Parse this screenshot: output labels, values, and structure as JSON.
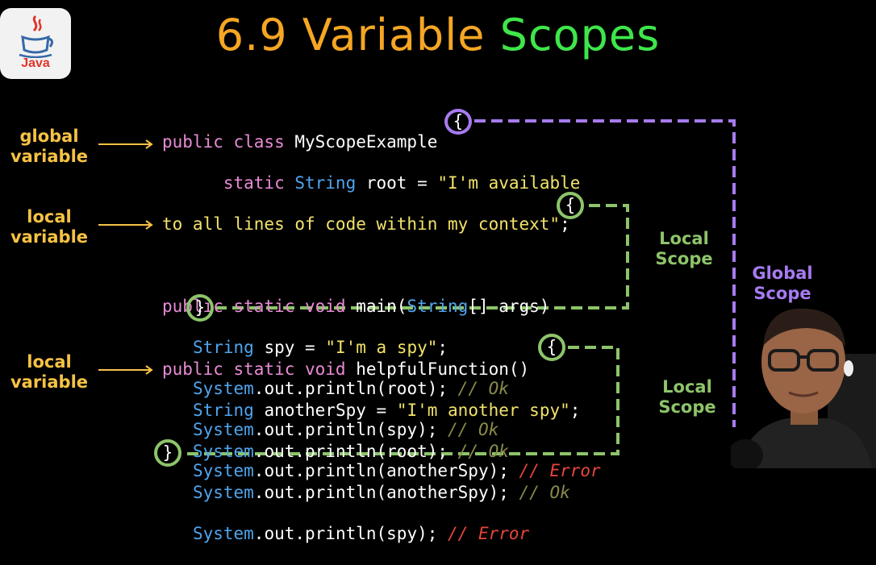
{
  "logo": {
    "text": "Java"
  },
  "title": {
    "part1": "6.9 Variable",
    "part2": "Scopes"
  },
  "side_labels": {
    "global": [
      "global",
      "variable"
    ],
    "local1": [
      "local",
      "variable"
    ],
    "local2": [
      "local",
      "variable"
    ]
  },
  "scope_labels": {
    "local1": [
      "Local",
      "Scope"
    ],
    "global": [
      "Global",
      "Scope"
    ],
    "local2": [
      "Local",
      "Scope"
    ]
  },
  "code": {
    "class_decl": {
      "kw": "public class",
      "name": " MyScopeExample "
    },
    "root_line": {
      "kw": "static",
      "type": " String",
      "rest": " root = ",
      "str": "\"I'm available"
    },
    "root_line2": {
      "str": "to all lines of code within my context\"",
      "end": ";"
    },
    "main_decl": {
      "kw": "public static void",
      "rest1": " main(",
      "type": "String",
      "rest2": "[] args) "
    },
    "spy_line": {
      "type": "String",
      "rest": " spy = ",
      "str": "\"I'm a spy\"",
      "end": ";"
    },
    "main_p1": {
      "type": "System",
      "rest": ".out.println(root); ",
      "comment": "// Ok"
    },
    "main_p2": {
      "type": "System",
      "rest": ".out.println(spy); ",
      "comment": "// Ok"
    },
    "main_p3": {
      "type": "System",
      "rest": ".out.println(anotherSpy); ",
      "comment": "// Error"
    },
    "helper_decl": {
      "kw": "public static void",
      "rest": " helpfulFunction() "
    },
    "another_line": {
      "type": "String",
      "rest": " anotherSpy = ",
      "str": "\"I'm another spy\"",
      "end": ";"
    },
    "helper_p1": {
      "type": "System",
      "rest": ".out.println(root); ",
      "comment": "// Ok"
    },
    "helper_p2": {
      "type": "System",
      "rest": ".out.println(anotherSpy); ",
      "comment": "// Ok"
    },
    "helper_p3": {
      "type": "System",
      "rest": ".out.println(spy); ",
      "comment": "// Error"
    },
    "open_brace": "{",
    "close_brace": "}"
  },
  "colors": {
    "global_scope": "#a77bf0",
    "local_scope": "#8dc46a",
    "label": "#f6c244",
    "title_orange": "#f5a623",
    "title_green": "#3ee64a"
  }
}
